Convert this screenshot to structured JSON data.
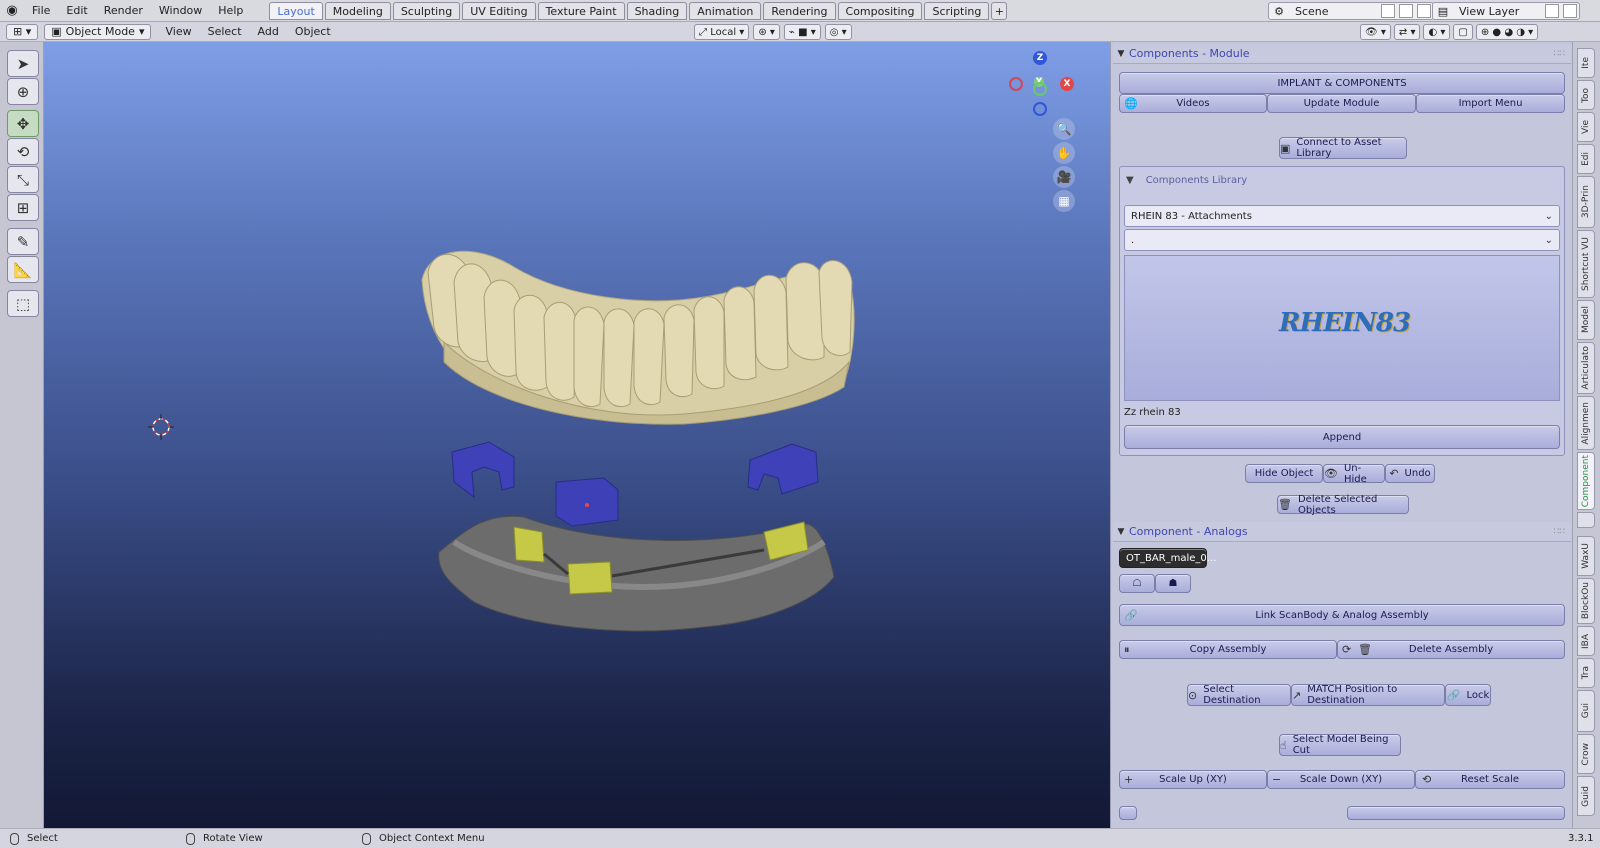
{
  "menu": [
    "File",
    "Edit",
    "Render",
    "Window",
    "Help"
  ],
  "workspaces": [
    "Layout",
    "Modeling",
    "Sculpting",
    "UV Editing",
    "Texture Paint",
    "Shading",
    "Animation",
    "Rendering",
    "Compositing",
    "Scripting"
  ],
  "active_workspace": "Layout",
  "scene": "Scene",
  "view_layer": "View Layer",
  "header": {
    "mode": "Object Mode",
    "menus": [
      "View",
      "Select",
      "Add",
      "Object"
    ],
    "orientation": "Local"
  },
  "gizmo": {
    "z": "Z",
    "y": "Y",
    "x": "X"
  },
  "panel_module": {
    "title": "Components - Module",
    "implant_btn": "IMPLANT & COMPONENTS",
    "videos": "Videos",
    "update": "Update Module",
    "import": "Import Menu",
    "connect": "Connect to Asset Library",
    "library_title": "Components Library",
    "library_select": "RHEIN 83 - Attachments",
    "library_sub": ".",
    "preview_logo": "RHEIN83",
    "preview_caption": "Zz rhein 83",
    "append": "Append",
    "hide": "Hide Object",
    "unhide": "Un-Hide",
    "undo": "Undo",
    "delete_selected": "Delete  Selected  Objects"
  },
  "panel_analogs": {
    "title": "Component - Analogs",
    "object_field": "OT_BAR_male_0...",
    "link": "Link ScanBody & Analog Assembly",
    "copy": "Copy Assembly",
    "delete": "Delete  Assembly",
    "select_dest": "Select Destination",
    "match": "MATCH Position to Destination",
    "lock": "Lock",
    "select_model": "Select Model Being Cut",
    "scale_up": "Scale Up (XY)",
    "scale_down": "Scale Down (XY)",
    "reset_scale": "Reset Scale"
  },
  "vtabs": [
    "Ite",
    "Too",
    "Vie",
    "Edi",
    "3D-Prin",
    "Shortcut VU",
    "Model",
    "Articulato",
    "Alignmen",
    "Component",
    "",
    "WaxU",
    "BlockOu",
    "IBA",
    "Tra",
    "Gui",
    "Crow",
    "Guid"
  ],
  "active_vtab": "Component",
  "status": {
    "select": "Select",
    "rotate": "Rotate View",
    "context": "Object Context Menu",
    "version": "3.3.1"
  }
}
